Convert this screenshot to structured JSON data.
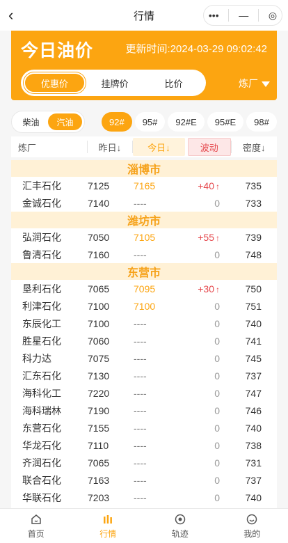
{
  "nav": {
    "title": "行情",
    "menu_icon": "•••",
    "minimize_icon": "—",
    "close_icon": "◎"
  },
  "header": {
    "title": "今日油价",
    "updated": "更新时间:2024-03-29 09:02:42",
    "tabs": [
      {
        "label": "优惠价",
        "active": true
      },
      {
        "label": "挂牌价",
        "active": false
      },
      {
        "label": "比价",
        "active": false
      }
    ],
    "refinery_filter": "炼厂"
  },
  "filters": {
    "fuel": [
      {
        "label": "柴油",
        "active": false
      },
      {
        "label": "汽油",
        "active": true
      }
    ],
    "grades": [
      {
        "label": "92#",
        "active": true
      },
      {
        "label": "95#",
        "active": false
      },
      {
        "label": "92#E",
        "active": false
      },
      {
        "label": "95#E",
        "active": false
      },
      {
        "label": "98#",
        "active": false
      }
    ]
  },
  "table": {
    "headers": {
      "refinery": "炼厂",
      "yesterday": "昨日↓",
      "today": "今日↓",
      "change": "波动",
      "density": "密度↓"
    },
    "groups": [
      {
        "city": "淄博市",
        "rows": [
          {
            "name": "汇丰石化",
            "yesterday": "7125",
            "today": "7165",
            "change": "+40",
            "up": true,
            "density": "735"
          },
          {
            "name": "金诚石化",
            "yesterday": "7140",
            "today": "----",
            "change": "0",
            "up": false,
            "density": "733"
          }
        ]
      },
      {
        "city": "潍坊市",
        "rows": [
          {
            "name": "弘润石化",
            "yesterday": "7050",
            "today": "7105",
            "change": "+55",
            "up": true,
            "density": "739"
          },
          {
            "name": "鲁清石化",
            "yesterday": "7160",
            "today": "----",
            "change": "0",
            "up": false,
            "density": "748"
          }
        ]
      },
      {
        "city": "东营市",
        "rows": [
          {
            "name": "垦利石化",
            "yesterday": "7065",
            "today": "7095",
            "change": "+30",
            "up": true,
            "density": "750"
          },
          {
            "name": "利津石化",
            "yesterday": "7100",
            "today": "7100",
            "change": "0",
            "up": false,
            "density": "751"
          },
          {
            "name": "东辰化工",
            "yesterday": "7100",
            "today": "----",
            "change": "0",
            "up": false,
            "density": "740"
          },
          {
            "name": "胜星石化",
            "yesterday": "7060",
            "today": "----",
            "change": "0",
            "up": false,
            "density": "741"
          },
          {
            "name": "科力达",
            "yesterday": "7075",
            "today": "----",
            "change": "0",
            "up": false,
            "density": "745"
          },
          {
            "name": "汇东石化",
            "yesterday": "7130",
            "today": "----",
            "change": "0",
            "up": false,
            "density": "737"
          },
          {
            "name": "海科化工",
            "yesterday": "7220",
            "today": "----",
            "change": "0",
            "up": false,
            "density": "747"
          },
          {
            "name": "海科瑞林",
            "yesterday": "7190",
            "today": "----",
            "change": "0",
            "up": false,
            "density": "746"
          },
          {
            "name": "东营石化",
            "yesterday": "7155",
            "today": "----",
            "change": "0",
            "up": false,
            "density": "740"
          },
          {
            "name": "华龙石化",
            "yesterday": "7110",
            "today": "----",
            "change": "0",
            "up": false,
            "density": "738"
          },
          {
            "name": "齐润石化",
            "yesterday": "7065",
            "today": "----",
            "change": "0",
            "up": false,
            "density": "731"
          },
          {
            "name": "联合石化",
            "yesterday": "7163",
            "today": "----",
            "change": "0",
            "up": false,
            "density": "737"
          },
          {
            "name": "华联石化",
            "yesterday": "7203",
            "today": "----",
            "change": "0",
            "up": false,
            "density": "740"
          }
        ]
      }
    ]
  },
  "tabbar": [
    {
      "label": "首页",
      "icon": "home-icon",
      "active": false
    },
    {
      "label": "行情",
      "icon": "market-icon",
      "active": true
    },
    {
      "label": "轨迹",
      "icon": "track-icon",
      "active": false
    },
    {
      "label": "我的",
      "icon": "profile-icon",
      "active": false
    }
  ],
  "colors": {
    "accent": "#fca511",
    "up": "#e5484d"
  }
}
